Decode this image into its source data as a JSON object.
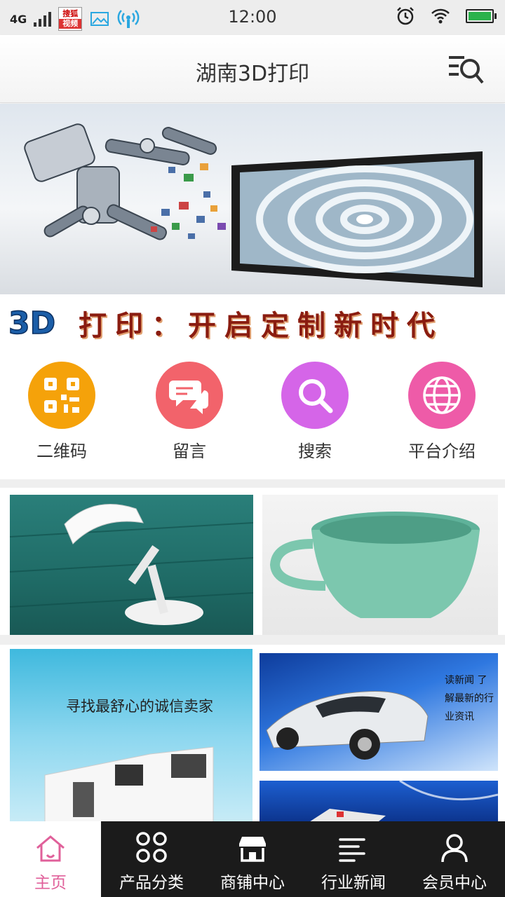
{
  "status_bar": {
    "network": "4G",
    "app_badge_top": "搜狐",
    "app_badge_bottom": "视频",
    "time": "12:00",
    "icons": [
      "signal-icon",
      "sohu-video-icon",
      "image-icon",
      "hotspot-icon",
      "alarm-icon",
      "wifi-icon",
      "battery-icon"
    ],
    "battery_color": "#2bb24c"
  },
  "header": {
    "title": "湖南3D打印",
    "menu_icon": "search-list-icon"
  },
  "banner": {
    "slogan_badge": "3D",
    "slogan": "打印：开启定制新时代",
    "slogan_color": "#8a1c10"
  },
  "quick_links": [
    {
      "label": "二维码",
      "icon": "qr-code-icon",
      "color": "#f5a20a"
    },
    {
      "label": "留言",
      "icon": "chat-icon",
      "color": "#f2636b"
    },
    {
      "label": "搜索",
      "icon": "search-icon",
      "color": "#d565e8"
    },
    {
      "label": "平台介绍",
      "icon": "globe-icon",
      "color": "#ee5ba8"
    }
  ],
  "tiles": {
    "seller_caption": "寻找最舒心的诚信卖家",
    "news_caption": "读新闻 了解最新的行业资讯"
  },
  "tabbar": {
    "active_color": "#e0609a",
    "items": [
      {
        "label": "主页",
        "icon": "home-icon",
        "active": true
      },
      {
        "label": "产品分类",
        "icon": "category-grid-icon",
        "active": false
      },
      {
        "label": "商铺中心",
        "icon": "store-icon",
        "active": false
      },
      {
        "label": "行业新闻",
        "icon": "news-icon",
        "active": false
      },
      {
        "label": "会员中心",
        "icon": "user-icon",
        "active": false
      }
    ]
  }
}
